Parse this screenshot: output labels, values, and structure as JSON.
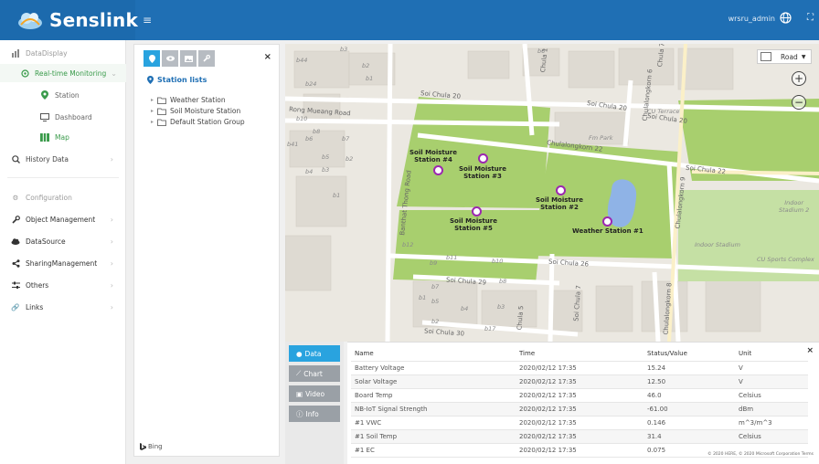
{
  "brand": {
    "name": "Senslink"
  },
  "topbar": {
    "user": "wrsru_admin",
    "menu_glyph": "≡",
    "more_glyph": "⛶"
  },
  "sidebar": {
    "data_display": "DataDisplay",
    "realtime": "Real-time Monitoring",
    "station": "Station",
    "dashboard": "Dashboard",
    "map": "Map",
    "history": "History Data",
    "configuration": "Configuration",
    "object_mgmt": "Object Management",
    "datasource": "DataSource",
    "sharing": "SharingManagement",
    "others": "Others",
    "links": "Links",
    "active_color": "#3a9b4b"
  },
  "panel": {
    "title": "Station lists",
    "items": [
      "Weather Station",
      "Soil Moisture Station",
      "Default Station Group"
    ],
    "close": "×",
    "bing": "Bing"
  },
  "map": {
    "road_select": "Road",
    "zoom_in": "+",
    "zoom_out": "−",
    "stations": [
      {
        "label": "Soil Moisture\nStation #4"
      },
      {
        "label": "Soil Moisture\nStation #3"
      },
      {
        "label": "Soil Moisture\nStation #2"
      },
      {
        "label": "Soil Moisture\nStation #5"
      },
      {
        "label": "Weather Station #1"
      }
    ],
    "streets": {
      "soi_chula_20a": "Soi Chula 20",
      "soi_chula_20b": "Soi Chula 20",
      "soi_chula_20c": "Soi Chula 20",
      "chulalongkorn_22": "Chulalongkorn 22",
      "soi_chula_22": "Soi Chula 22",
      "soi_chula_26": "Soi Chula 26",
      "soi_chula_29": "Soi Chula 29",
      "soi_chula_30": "Soi Chula 30",
      "banthat_thong": "Banthat Thong Road",
      "chula_1": "Chula 1",
      "chulalongkorn_9": "Chulalongkorn 9",
      "soi_chula_7": "Soi Chula 7",
      "chula_5": "Chula 5",
      "chulalongkorn_8": "Chulalongkorn 8",
      "chulalongkorn_6": "Chulalongkorn 6",
      "chula_7": "Chula 7",
      "rong_muang": "Rong Mueang Road"
    },
    "places": {
      "cu_terrace": "CU Terrace",
      "fm_park": "Fm Park",
      "indoor_stadium": "Indoor Stadium",
      "indoor_stadium2": "Indoor\nStadium 2",
      "cu_sports": "CU Sports Complex"
    },
    "blocks": [
      "b3",
      "b44",
      "b2",
      "b24",
      "b1",
      "b10",
      "b8",
      "b6",
      "b41",
      "b7",
      "b5",
      "b4",
      "b3",
      "b2",
      "b1",
      "b12",
      "b11",
      "b9",
      "b10",
      "b8",
      "b7",
      "b5",
      "b4",
      "b3",
      "b1",
      "b2",
      "b17",
      "b6"
    ]
  },
  "tabs": {
    "data": "Data",
    "chart": "Chart",
    "video": "Video",
    "info": "Info"
  },
  "table": {
    "headers": [
      "Name",
      "Time",
      "Status/Value",
      "Unit"
    ],
    "rows": [
      [
        "Battery Voltage",
        "2020/02/12 17:35",
        "15.24",
        "V"
      ],
      [
        "Solar Voltage",
        "2020/02/12 17:35",
        "12.50",
        "V"
      ],
      [
        "Board Temp",
        "2020/02/12 17:35",
        "46.0",
        "Celsius"
      ],
      [
        "NB-IoT Signal Strength",
        "2020/02/12 17:35",
        "-61.00",
        "dBm"
      ],
      [
        "#1 VWC",
        "2020/02/12 17:35",
        "0.146",
        "m^3/m^3"
      ],
      [
        "#1 Soil Temp",
        "2020/02/12 17:35",
        "31.4",
        "Celsius"
      ],
      [
        "#1 EC",
        "2020/02/12 17:35",
        "0.075",
        ""
      ]
    ],
    "close": "×",
    "copyright": "© 2020 HERE, © 2020 Microsoft Corporation Terms"
  },
  "colors": {
    "topbar": "#1f6fb4",
    "accent": "#29a3df",
    "pin": "#9c27b0",
    "park": "#a8cf6e"
  }
}
